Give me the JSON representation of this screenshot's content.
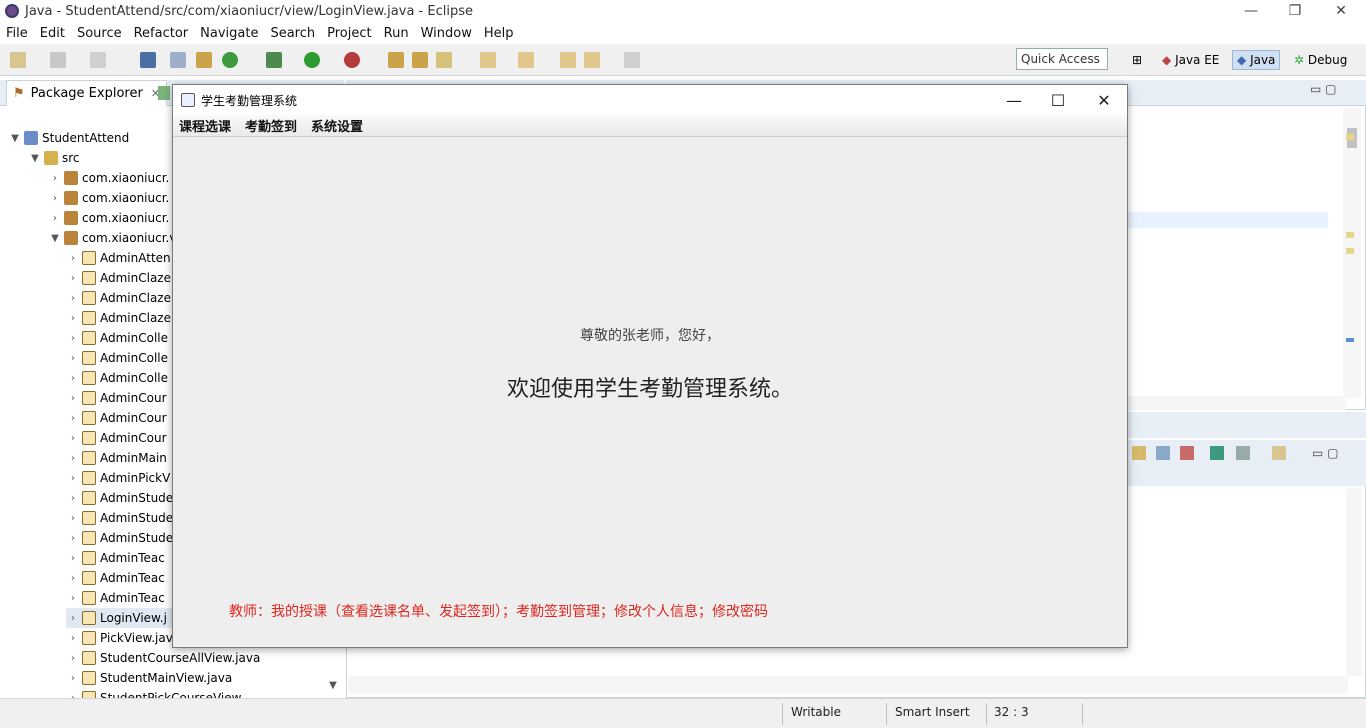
{
  "window": {
    "title": "Java - StudentAttend/src/com/xiaoniucr/view/LoginView.java - Eclipse"
  },
  "menu": [
    "File",
    "Edit",
    "Source",
    "Refactor",
    "Navigate",
    "Search",
    "Project",
    "Run",
    "Window",
    "Help"
  ],
  "quick_access": "Quick Access",
  "perspectives": [
    "Java EE",
    "Java",
    "Debug"
  ],
  "package_explorer": {
    "tab_label": "Package Explorer",
    "project": "StudentAttend",
    "src": "src",
    "packages": [
      "com.xiaoniucr.",
      "com.xiaoniucr.",
      "com.xiaoniucr.",
      "com.xiaoniucr.v"
    ],
    "files": [
      "AdminAtten",
      "AdminClaze",
      "AdminClaze",
      "AdminClaze",
      "AdminColle",
      "AdminColle",
      "AdminColle",
      "AdminCour",
      "AdminCour",
      "AdminCour",
      "AdminMain",
      "AdminPickV",
      "AdminStude",
      "AdminStude",
      "AdminStude",
      "AdminTeac",
      "AdminTeac",
      "AdminTeac",
      "LoginView.j",
      "PickView.jav",
      "StudentCourseAllView.java",
      "StudentMainView.java",
      "StudentPickCourseView"
    ]
  },
  "status": {
    "writable": "Writable",
    "insert_mode": "Smart Insert",
    "position": "32 : 3"
  },
  "dialog": {
    "title": "学生考勤管理系统",
    "menu": [
      "课程选课",
      "考勤签到",
      "系统设置"
    ],
    "greeting": "尊敬的张老师，您好，",
    "welcome": "欢迎使用学生考勤管理系统。",
    "info": "教师：我的授课（查看选课名单、发起签到）；考勤签到管理；修改个人信息；修改密码"
  },
  "colors": {
    "info_red": "#e0261f",
    "selection": "#dfe8f3"
  }
}
